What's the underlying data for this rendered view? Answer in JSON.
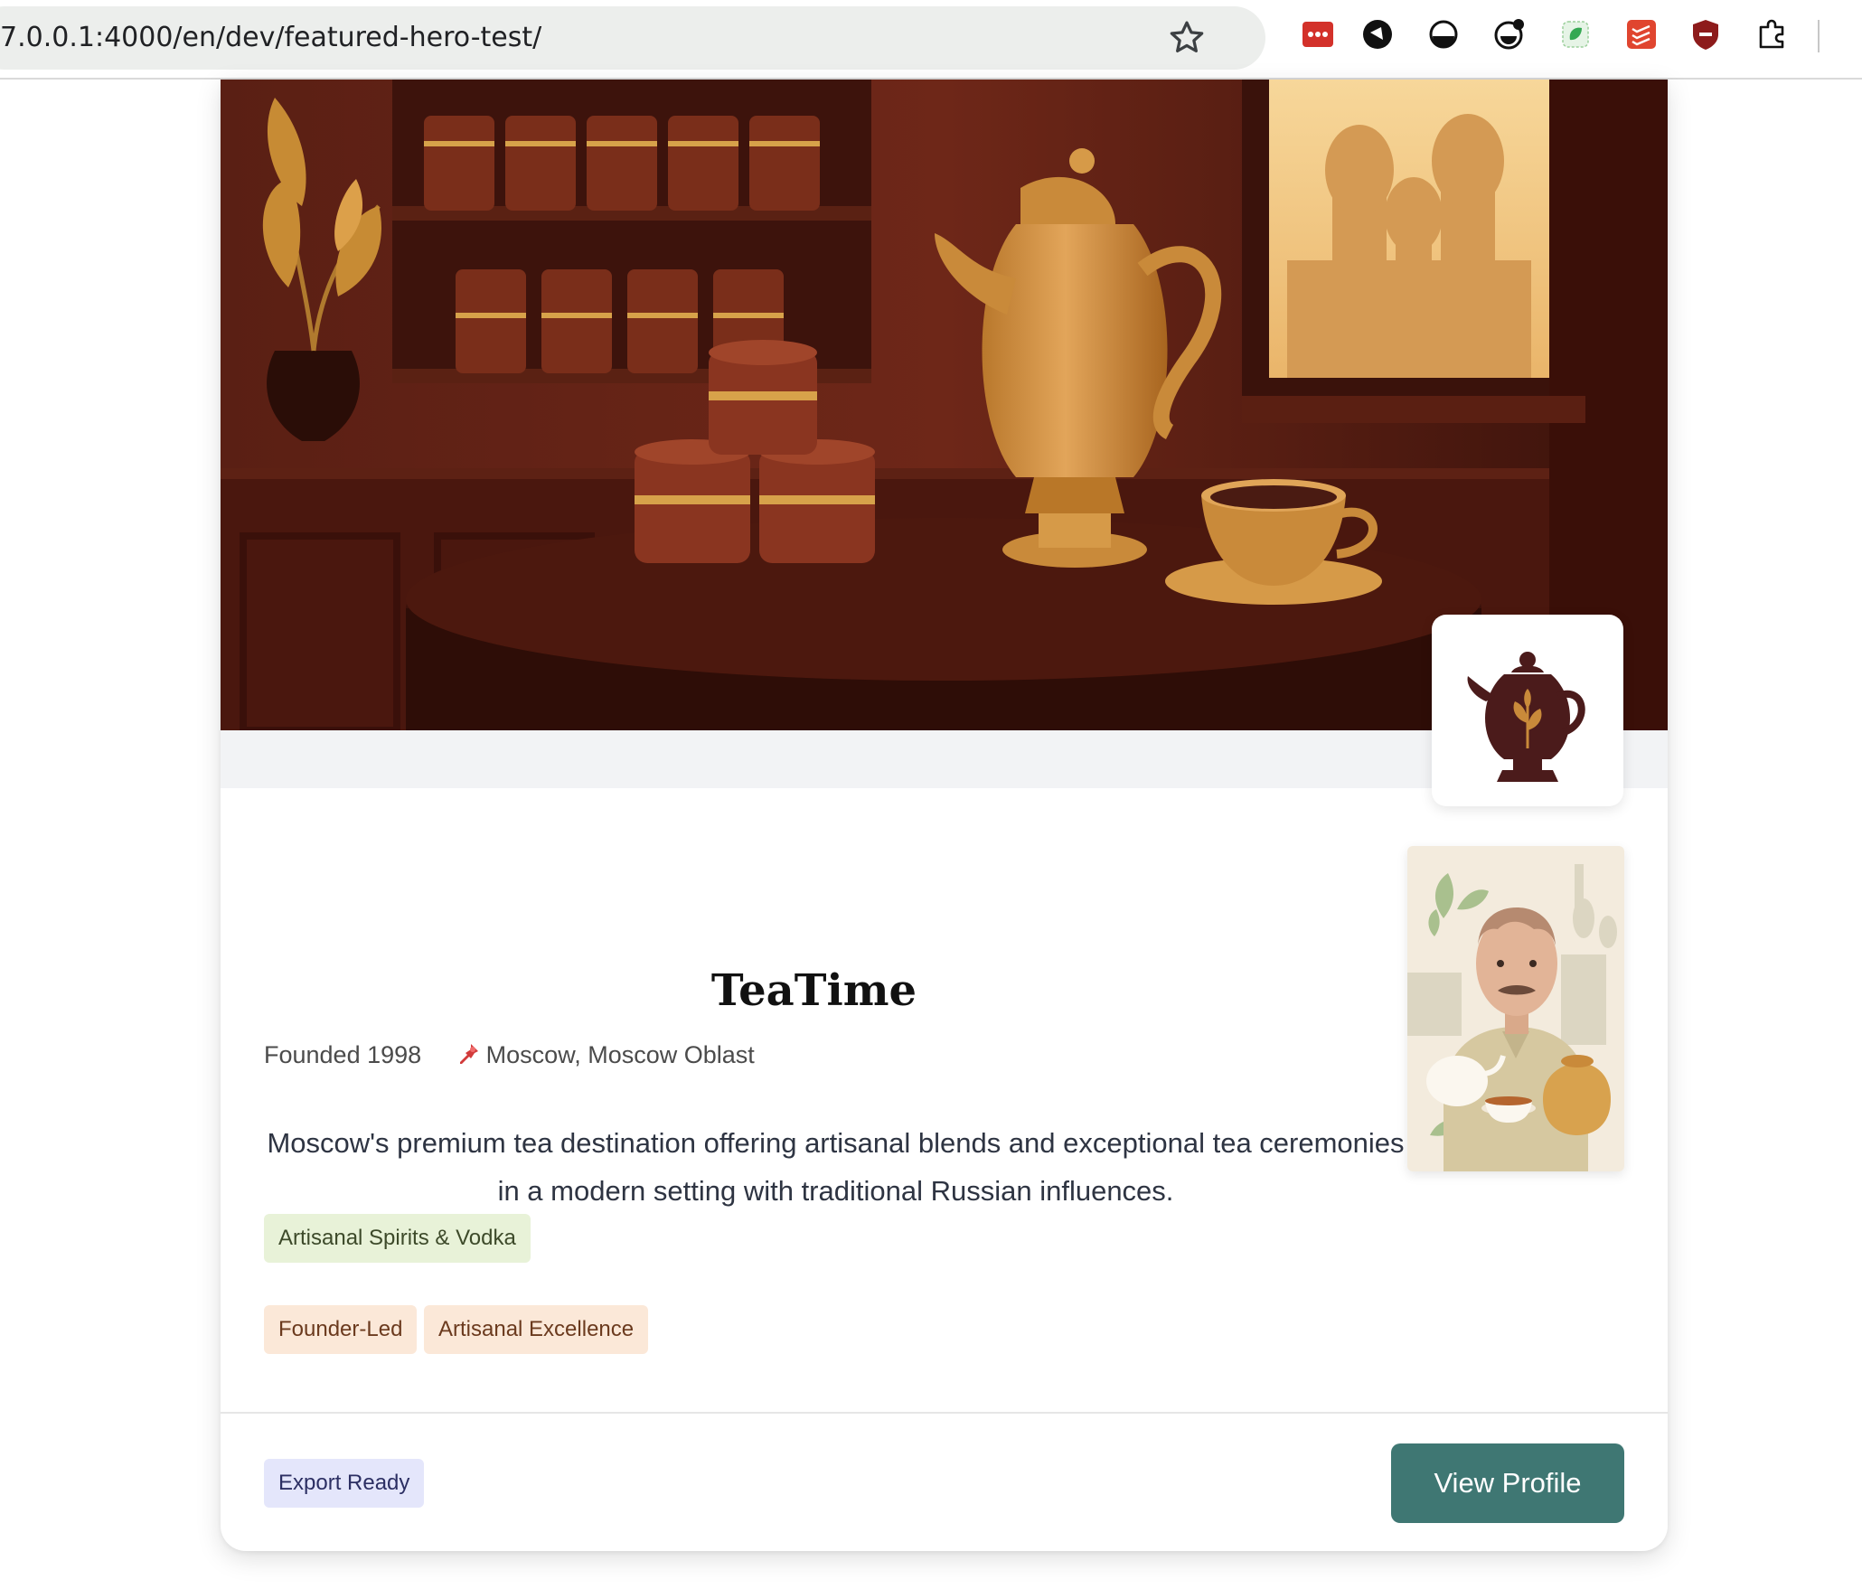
{
  "browser": {
    "url": "7.0.0.1:4000/en/dev/featured-hero-test/",
    "bookmark_icon": "star-icon",
    "extensions": [
      "extension-red-dots-icon",
      "extension-black-circle-icon",
      "extension-half-circle-icon",
      "extension-smiley-icon",
      "extension-green-leaf-icon",
      "extension-red-list-icon",
      "extension-shield-icon",
      "puzzle-icon"
    ]
  },
  "business": {
    "name": "TeaTime",
    "founded": "Founded 1998",
    "location": "Moscow, Moscow Oblast",
    "location_icon": "pushpin-icon",
    "description": "Moscow's premium tea destination offering artisanal blends and exceptional tea ceremonies in a modern setting with traditional Russian influences.",
    "category_tag": "Artisanal Spirits & Vodka",
    "trait_tags": [
      "Founder-Led",
      "Artisanal Excellence"
    ],
    "status_badge": "Export Ready"
  },
  "actions": {
    "view_profile": "View Profile"
  },
  "colors": {
    "button": "#3f7773",
    "hero_dark": "#4a1b12",
    "accent_gold": "#c98a3a"
  }
}
